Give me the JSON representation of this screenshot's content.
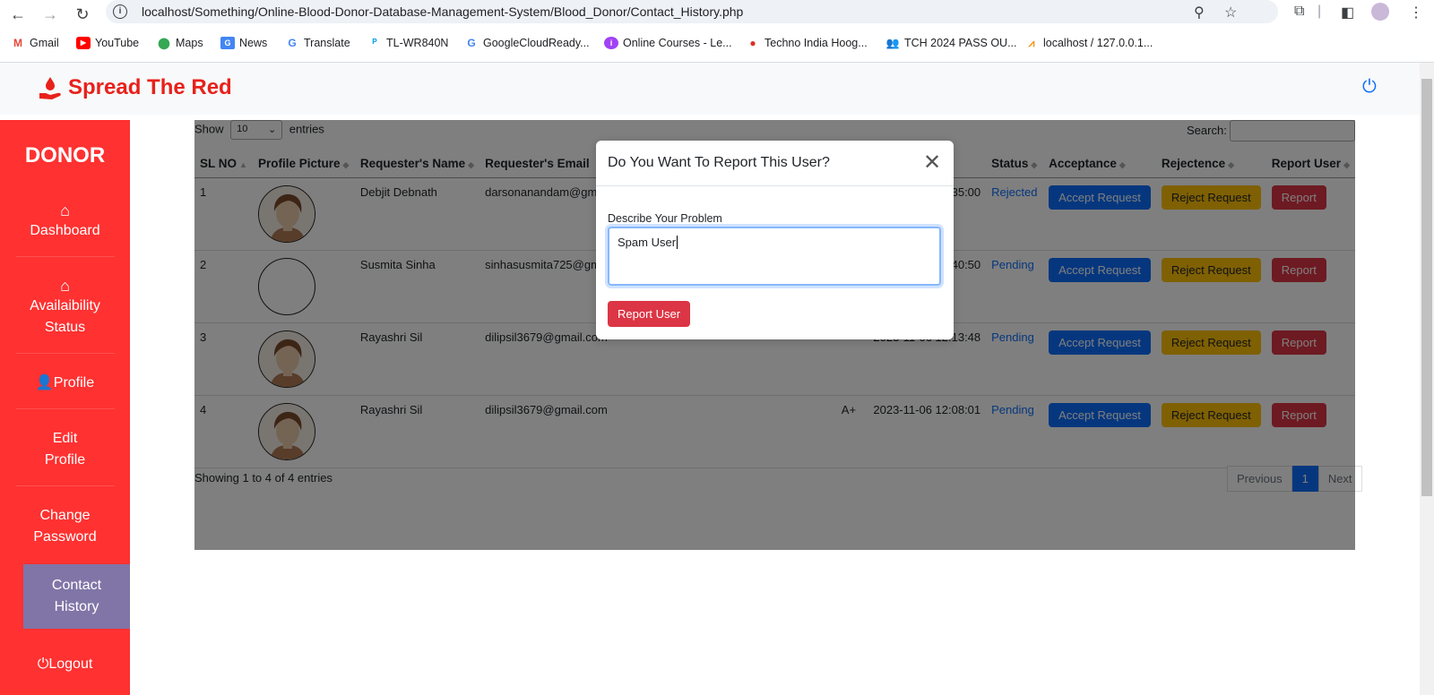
{
  "browser": {
    "url_host": "localhost",
    "url_path": "/Something/Online-Blood-Donor-Database-Management-System/Blood_Donor/Contact_History.php",
    "bookmarks": [
      "Gmail",
      "YouTube",
      "Maps",
      "News",
      "Translate",
      "TL-WR840N",
      "GoogleCloudReady...",
      "Online Courses - Le...",
      "Techno India Hoog...",
      "TCH 2024 PASS OU...",
      "localhost / 127.0.0.1..."
    ]
  },
  "brand": {
    "name": "Spread The Red",
    "color": "#e8211b"
  },
  "sidebar": {
    "title": "DONOR",
    "items": [
      {
        "label": "Dashboard",
        "icon": "home-icon"
      },
      {
        "label": "Availaibility Status",
        "icon": "home-icon"
      },
      {
        "label": "Profile",
        "icon": "user-icon"
      },
      {
        "label": "Edit Profile",
        "icon": "id-card-icon"
      },
      {
        "label": "Change Password",
        "icon": "file-icon"
      },
      {
        "label": "Contact History",
        "icon": "file-icon"
      },
      {
        "label": "Logout",
        "icon": "power-icon"
      }
    ]
  },
  "table": {
    "show_label": "Show",
    "entries_value": "10",
    "entries_label": "entries",
    "search_label": "Search:",
    "headers": [
      "SL NO",
      "Profile Picture",
      "Requester's Name",
      "Requester's Email",
      "",
      "",
      "Status",
      "Acceptance",
      "Rejectence",
      "Report User"
    ],
    "rows": [
      {
        "sl": "1",
        "name": "Debjit Debnath",
        "email": "darsonanandam@gmail.com",
        "blood": "",
        "time": "2023-11-06 12:35:00",
        "status": "Rejected",
        "avatar": "photo"
      },
      {
        "sl": "2",
        "name": "Susmita Sinha",
        "email": "sinhasusmita725@gmail.com",
        "blood": "",
        "time": "2023-11-06 12:40:50",
        "status": "Pending",
        "avatar": "blank"
      },
      {
        "sl": "3",
        "name": "Rayashri Sil",
        "email": "dilipsil3679@gmail.com",
        "blood": "",
        "time": "2023-11-06 12:13:48",
        "status": "Pending",
        "avatar": "photo"
      },
      {
        "sl": "4",
        "name": "Rayashri Sil",
        "email": "dilipsil3679@gmail.com",
        "blood": "A+",
        "time": "2023-11-06 12:08:01",
        "status": "Pending",
        "avatar": "photo"
      }
    ],
    "accept_label": "Accept Request",
    "reject_label": "Reject Request",
    "report_label": "Report",
    "footer": "Showing 1 to 4 of 4 entries",
    "pager": {
      "prev": "Previous",
      "page": "1",
      "next": "Next"
    }
  },
  "modal": {
    "title": "Do You Want To Report This User?",
    "field_label": "Describe Your Problem",
    "field_value": "Spam User",
    "submit_label": "Report User"
  }
}
